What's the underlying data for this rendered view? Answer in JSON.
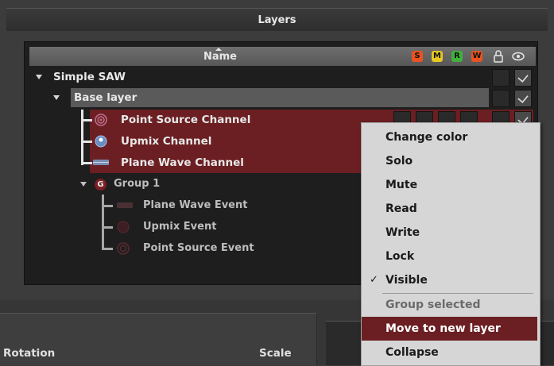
{
  "panel": {
    "title": "Layers"
  },
  "header": {
    "name_col": "Name",
    "badges": [
      {
        "letter": "S",
        "color": "#e8531f"
      },
      {
        "letter": "M",
        "color": "#e8c81f"
      },
      {
        "letter": "R",
        "color": "#3fb13c"
      },
      {
        "letter": "W",
        "color": "#e8531f"
      }
    ]
  },
  "tree": {
    "root": "Simple SAW",
    "layer": "Base layer",
    "channels": [
      "Point Source Channel",
      "Upmix Channel",
      "Plane Wave Channel"
    ],
    "group": {
      "badge": "G",
      "label": "Group 1",
      "events": [
        "Plane Wave Event",
        "Upmix Event",
        "Point Source Event"
      ]
    }
  },
  "bottom": {
    "rotation_label": "Rotation",
    "scale_label": "Scale"
  },
  "context_menu": {
    "items": [
      {
        "label": "Change color"
      },
      {
        "label": "Solo"
      },
      {
        "label": "Mute"
      },
      {
        "label": "Read"
      },
      {
        "label": "Write"
      },
      {
        "label": "Lock"
      },
      {
        "label": "Visible",
        "checked": true
      },
      {
        "label": "Group selected",
        "disabled": true
      },
      {
        "label": "Move to new layer",
        "highlighted": true
      },
      {
        "label": "Collapse"
      }
    ],
    "tick": "✓"
  },
  "colors": {
    "selection": "#6b1f22",
    "accent_red": "#c03a3a"
  }
}
